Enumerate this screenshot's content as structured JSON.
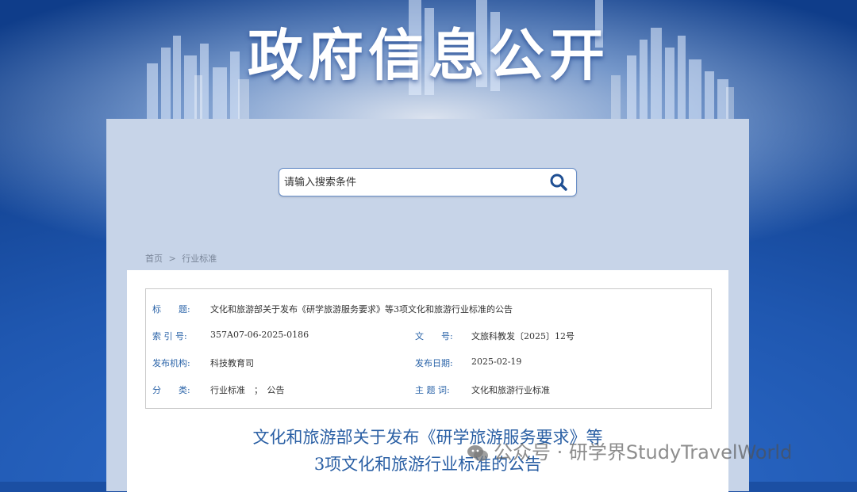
{
  "header": {
    "title": "政府信息公开"
  },
  "search": {
    "placeholder": "请输入搜索条件"
  },
  "breadcrumb": {
    "home": "首页",
    "separator": ">",
    "current": "行业标准"
  },
  "meta": {
    "title_label": "标　　题:",
    "title_value": "文化和旅游部关于发布《研学旅游服务要求》等3项文化和旅游行业标准的公告",
    "index_label": "索 引 号:",
    "index_value": "357A07-06-2025-0186",
    "docno_label": "文　　号:",
    "docno_value": "文旅科教发〔2025〕12号",
    "org_label": "发布机构:",
    "org_value": "科技教育司",
    "date_label": "发布日期:",
    "date_value": "2025-02-19",
    "category_label": "分　　类:",
    "category_value": "行业标准　；　公告",
    "keyword_label": "主 题 词:",
    "keyword_value": "文化和旅游行业标准"
  },
  "doc": {
    "title_line1": "文化和旅游部关于发布《研学旅游服务要求》等",
    "title_line2": "3项文化和旅游行业标准的公告"
  },
  "watermark": {
    "text": "公众号 · 研学界StudyTravelWorld"
  },
  "colors": {
    "label": "#2a63a8",
    "title": "#2a5fa4",
    "panel": "#c7d4e8",
    "banner": "#1b4fa3"
  },
  "icons": {
    "search": "search-icon",
    "wechat": "wechat-icon"
  }
}
